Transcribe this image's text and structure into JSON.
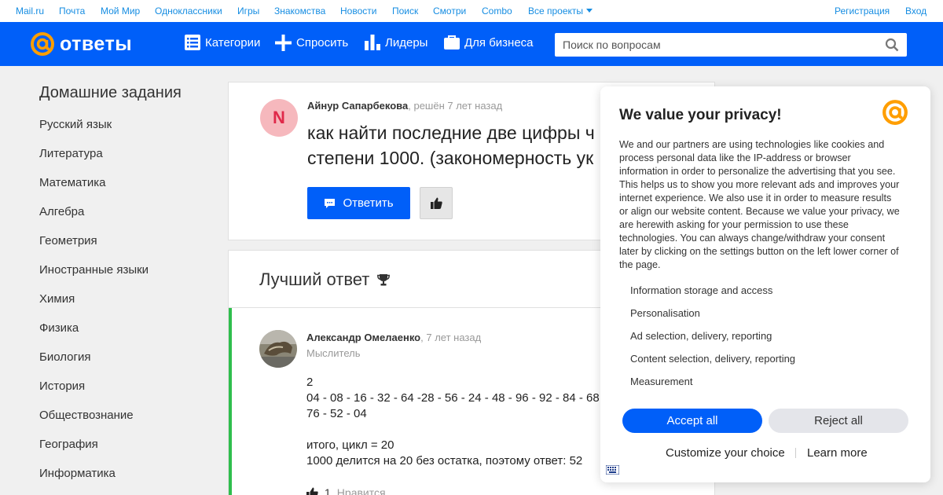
{
  "portal": {
    "links": [
      "Mail.ru",
      "Почта",
      "Мой Мир",
      "Одноклассники",
      "Игры",
      "Знакомства",
      "Новости",
      "Поиск",
      "Смотри",
      "Combo",
      "Все проекты"
    ],
    "register": "Регистрация",
    "login": "Вход"
  },
  "header": {
    "logo_text": "ответы",
    "nav": [
      "Категории",
      "Спросить",
      "Лидеры",
      "Для бизнеса"
    ],
    "search_placeholder": "Поиск по вопросам"
  },
  "sidebar": {
    "title": "Домашние задания",
    "items": [
      "Русский язык",
      "Литература",
      "Математика",
      "Алгебра",
      "Геометрия",
      "Иностранные языки",
      "Химия",
      "Физика",
      "Биология",
      "История",
      "Обществознание",
      "География",
      "Информатика"
    ]
  },
  "question": {
    "avatar_letter": "N",
    "author": "Айнур Сапарбекова",
    "meta": ", решён 7 лет назад",
    "title_lines": [
      "как найти последние две цифры ч",
      "степени 1000. (закономерность ук"
    ],
    "answer_button": "Ответить"
  },
  "best_answer": {
    "heading": "Лучший ответ",
    "author": "Александр Омелаенко",
    "meta": ", 7 лет назад",
    "rank": "Мыслитель",
    "body_lines": [
      "2",
      "04 - 08 - 16 - 32 - 64 -28 - 56 - 24 - 48 - 96 - 92 - 84 - 68 -",
      "76 - 52 - 04",
      "",
      "итого, цикл = 20",
      "1000 делится на 20 без остатка, поэтому ответ: 52"
    ],
    "likes_count": "1",
    "likes_label": "Нравится"
  },
  "consent": {
    "title": "We value your privacy!",
    "text": "We and our partners are using technologies like cookies and process personal data like the IP-address or browser information in order to personalize the advertising that you see. This helps us to show you more relevant ads and improves your internet experience. We also use it in order to measure results or align our website content. Because we value your privacy, we are herewith asking for your permission to use these technologies. You can always change/withdraw your consent later by clicking on the settings button on the left lower corner of the page.",
    "purposes": [
      "Information storage and access",
      "Personalisation",
      "Ad selection, delivery, reporting",
      "Content selection, delivery, reporting",
      "Measurement"
    ],
    "accept": "Accept all",
    "reject": "Reject all",
    "customize": "Customize your choice",
    "learn_more": "Learn more"
  },
  "colors": {
    "brand_blue": "#005ff9",
    "link_blue": "#168de2",
    "best_answer_green": "#2fbe4d",
    "logo_orange": "#ff9e00"
  }
}
